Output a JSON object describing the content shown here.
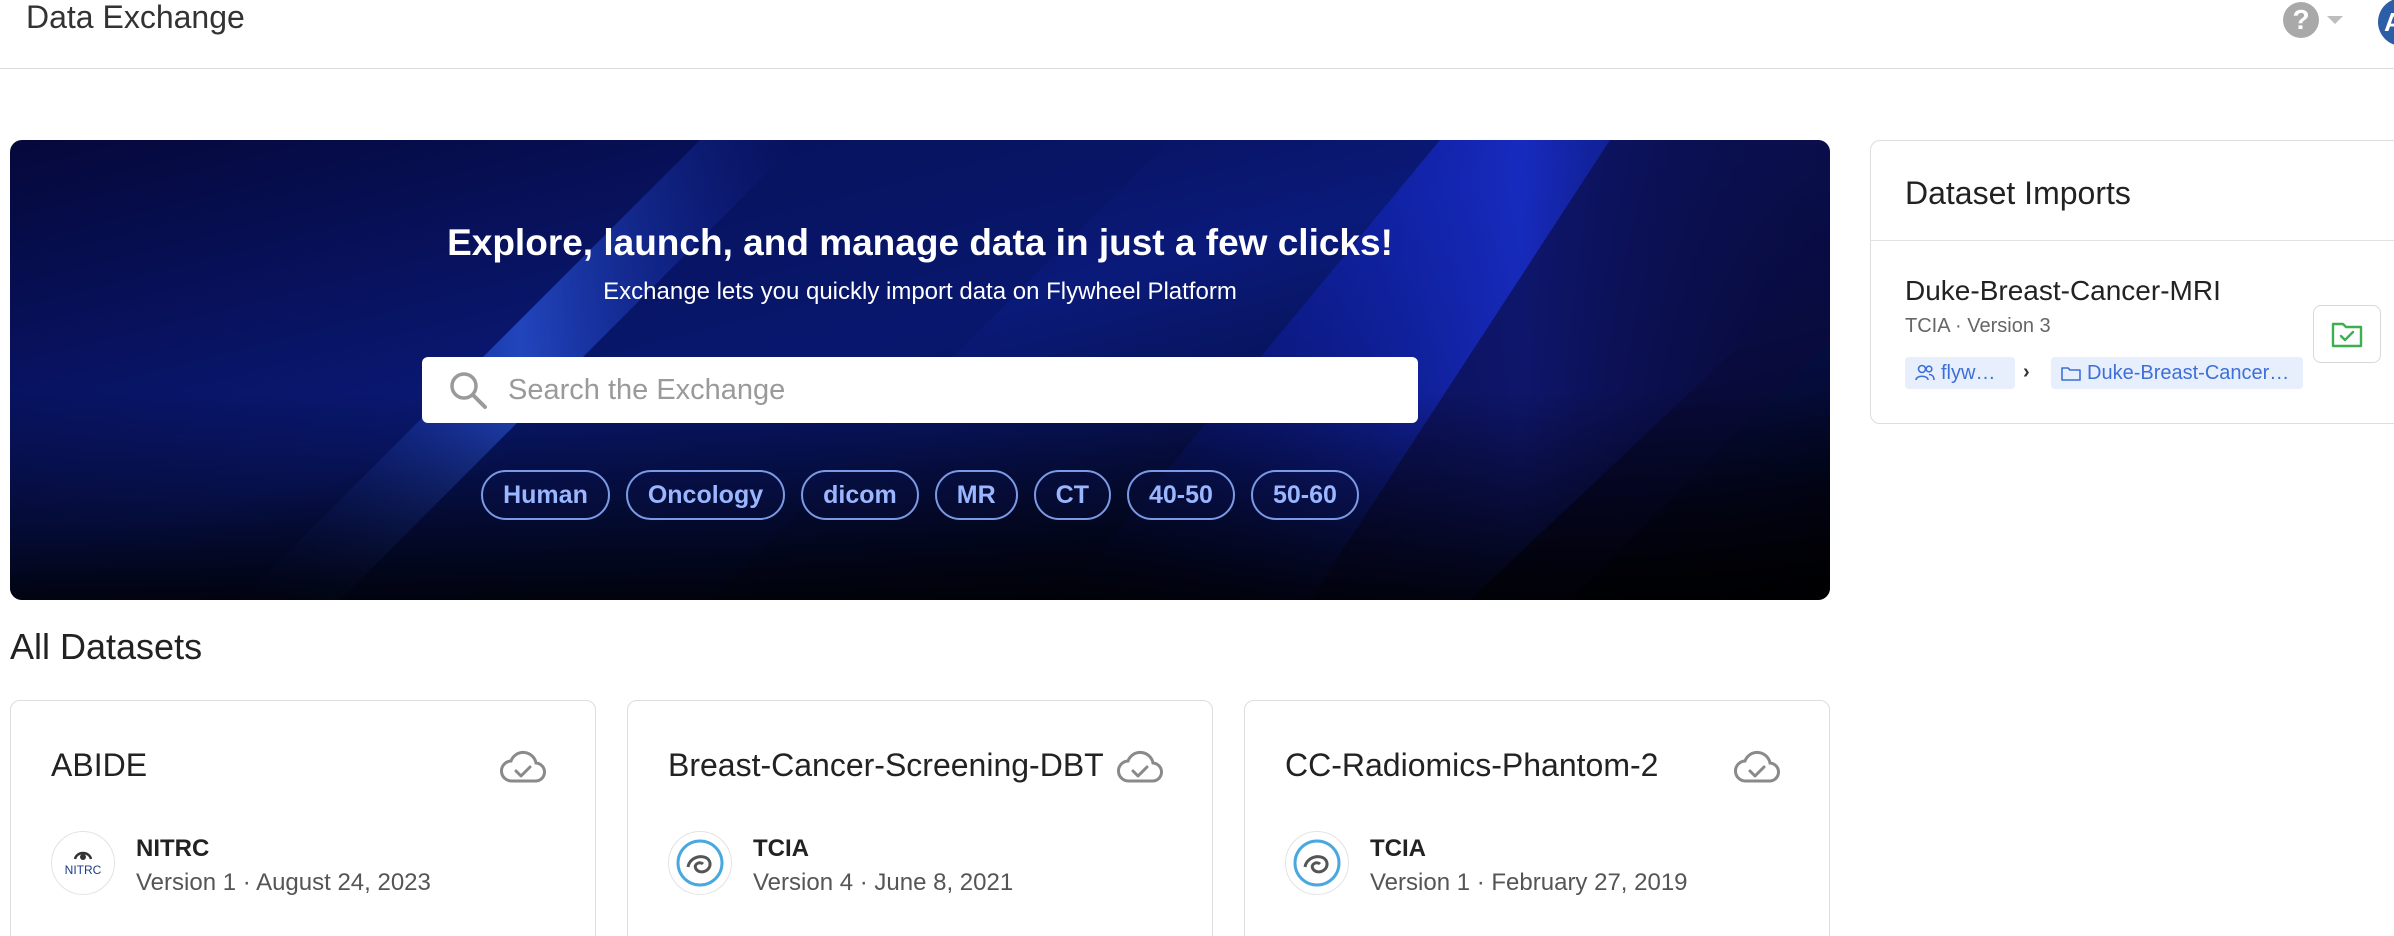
{
  "header": {
    "title": "Data Exchange",
    "avatar_initial": "A"
  },
  "hero": {
    "title": "Explore, launch, and manage data in just a few clicks!",
    "subtitle": "Exchange lets you quickly import data on Flywheel Platform",
    "search_placeholder": "Search the Exchange",
    "search_value": "",
    "chips": [
      "Human",
      "Oncology",
      "dicom",
      "MR",
      "CT",
      "40-50",
      "50-60"
    ]
  },
  "datasets_section": {
    "title": "All Datasets",
    "cards": [
      {
        "title": "ABIDE",
        "org": "NITRC",
        "meta": "Version 1 · August 24, 2023",
        "logo": "nitrc-logo"
      },
      {
        "title": "Breast-Cancer-Screening-DBT",
        "org": "TCIA",
        "meta": "Version 4 · June 8, 2021",
        "logo": "tcia-logo"
      },
      {
        "title": "CC-Radiomics-Phantom-2",
        "org": "TCIA",
        "meta": "Version 1 · February 27, 2019",
        "logo": "tcia-logo"
      }
    ]
  },
  "imports_panel": {
    "title": "Dataset Imports",
    "item": {
      "name": "Duke-Breast-Cancer-MRI",
      "meta": "TCIA · Version 3",
      "group_tag": "flyw…",
      "project_tag": "Duke-Breast-Cancer…"
    }
  },
  "colors": {
    "hero_base": "#02021a",
    "hero_accent": "#1e40c8",
    "chip_border": "#7b9ae6",
    "chip_text": "#9ab6ff",
    "tag_bg": "#e7effc",
    "tag_text": "#3e6fd8",
    "success_green": "#3fae4e",
    "icon_gray": "#8a8a8a"
  }
}
